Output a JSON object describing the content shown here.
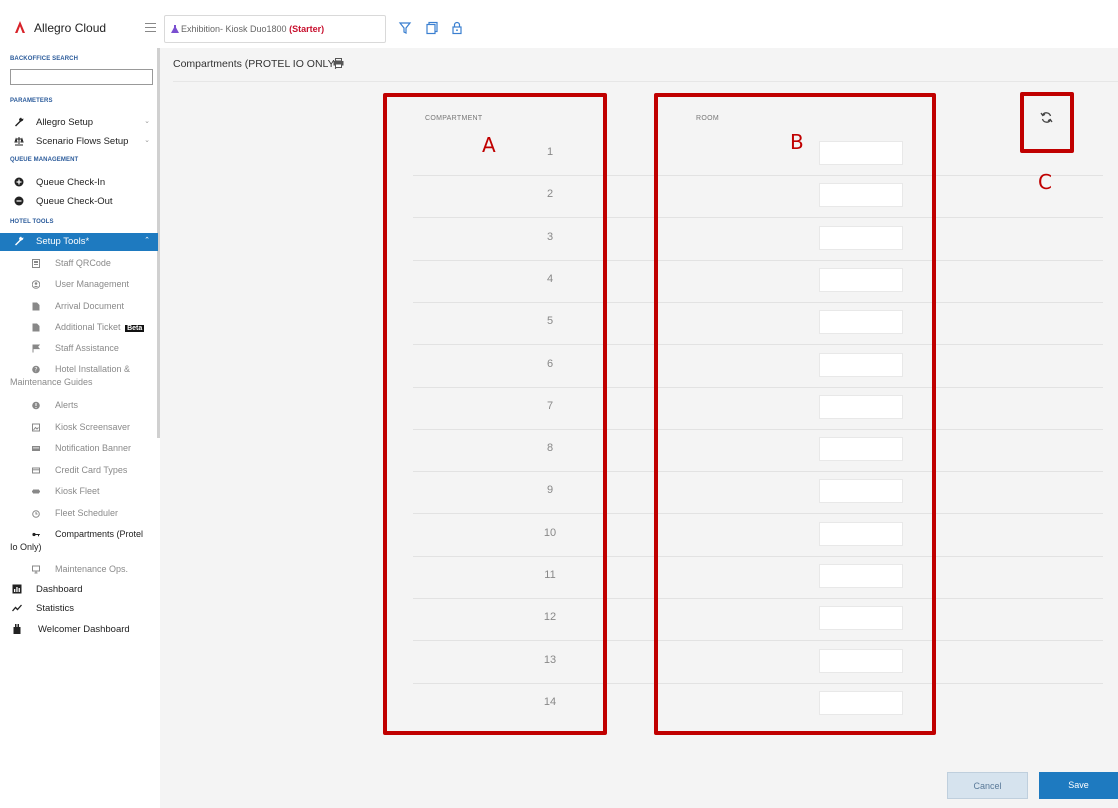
{
  "app": {
    "brand": "Allegro Cloud"
  },
  "context": {
    "name": "Exhibition- Kiosk Duo1800",
    "tier": "(Starter)"
  },
  "colors": {
    "accent": "#1e7ac0",
    "brand": "#d8232a",
    "annotation": "#c00000",
    "tier": "#c8102e"
  },
  "sidebar": {
    "backoffice_title": "BACKOFFICE SEARCH",
    "search_value": "",
    "parameters_title": "PARAMETERS",
    "allegro_setup": "Allegro Setup",
    "scenario_flows": "Scenario Flows Setup",
    "queue_title": "QUEUE MANAGEMENT",
    "queue_checkin": "Queue Check-In",
    "queue_checkout": "Queue Check-Out",
    "hotel_tools_title": "HOTEL TOOLS",
    "setup_tools": "Setup Tools*",
    "sub_items": {
      "staff_qrcode": "Staff QRCode",
      "user_management": "User Management",
      "arrival_document": "Arrival Document",
      "additional_ticket": "Additional Ticket",
      "beta_badge": "Beta",
      "staff_assistance": "Staff Assistance",
      "hotel_installation": "Hotel Installation &",
      "hotel_installation_2": "Maintenance Guides",
      "alerts": "Alerts",
      "kiosk_screensaver": "Kiosk Screensaver",
      "notification_banner": "Notification Banner",
      "credit_card_types": "Credit Card Types",
      "kiosk_fleet": "Kiosk Fleet",
      "fleet_scheduler": "Fleet Scheduler",
      "compartments": "Compartments (Protel",
      "compartments_2": "Io Only)",
      "maintenance_ops": "Maintenance Ops."
    },
    "dashboard": "Dashboard",
    "statistics": "Statistics",
    "welcomer_dashboard": "Welcomer Dashboard"
  },
  "main": {
    "title": "Compartments (PROTEL IO ONLY)",
    "col_compartment": "COMPARTMENT",
    "col_room": "ROOM",
    "rows": [
      "1",
      "2",
      "3",
      "4",
      "5",
      "6",
      "7",
      "8",
      "9",
      "10",
      "11",
      "12",
      "13",
      "14"
    ],
    "room_values": [
      "",
      "",
      "",
      "",
      "",
      "",
      "",
      "",
      "",
      "",
      "",
      "",
      "",
      ""
    ]
  },
  "annotations": {
    "a": "A",
    "b": "B",
    "c": "C"
  },
  "buttons": {
    "cancel": "Cancel",
    "save": "Save"
  },
  "icons": [
    "hamburger-icon",
    "flask-icon",
    "filter-icon",
    "copy-icon",
    "lock-icon",
    "print-icon",
    "refresh-icon",
    "wrench-icon",
    "scale-icon",
    "plus-circle-icon",
    "minus-circle-icon",
    "qr-icon",
    "user-circle-icon",
    "document-icon",
    "flag-icon",
    "help-icon",
    "alert-icon",
    "screensaver-icon",
    "banner-icon",
    "credit-card-icon",
    "kiosk-icon",
    "clock-icon",
    "key-icon",
    "monitor-icon",
    "dashboard-icon",
    "statistics-icon",
    "welcomer-icon"
  ]
}
